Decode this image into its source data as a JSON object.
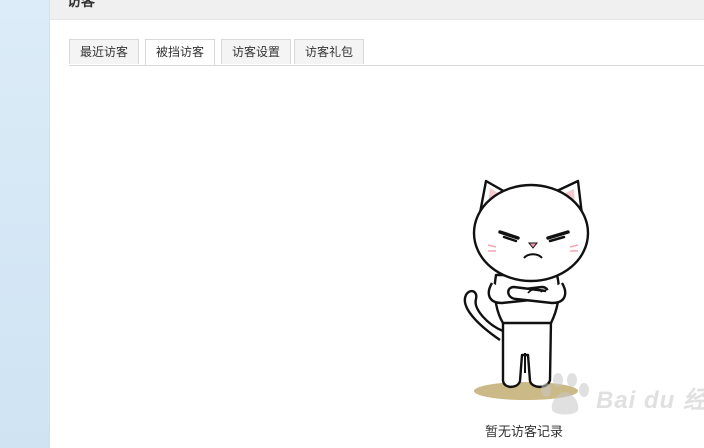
{
  "header": {
    "title": "访客"
  },
  "tabs": [
    {
      "label": "最近访客",
      "active": false
    },
    {
      "label": "被挡访客",
      "active": true
    },
    {
      "label": "访客设置",
      "active": false
    },
    {
      "label": "访客礼包",
      "active": false
    }
  ],
  "empty_state": {
    "message": "暂无访客记录",
    "illustration": "cat-icon"
  },
  "watermark": {
    "text": "Bai du 经验"
  },
  "colors": {
    "left_strip": "#d3e6f5",
    "tab_border": "#d9d9d9",
    "tab_inactive_bg": "#f4f4f4"
  }
}
